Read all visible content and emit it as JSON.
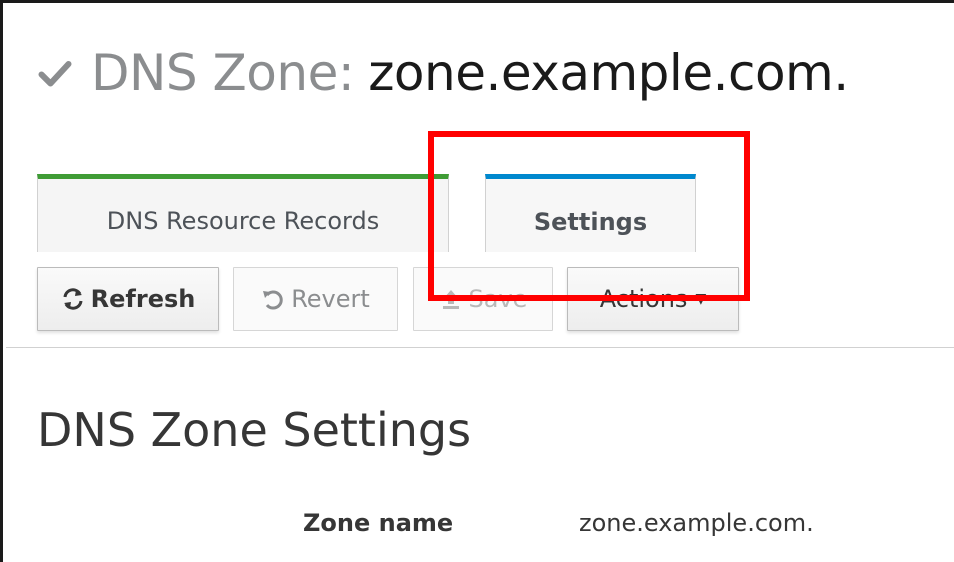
{
  "page": {
    "title_prefix": "DNS Zone:",
    "title_name": "zone.example.com.",
    "status_icon": "check-icon"
  },
  "tabs": [
    {
      "label": "DNS Resource Records",
      "accent": "#3f9c35",
      "active": false
    },
    {
      "label": "Settings",
      "accent": "#0088ce",
      "active": true
    }
  ],
  "toolbar": {
    "refresh_label": "Refresh",
    "refresh_icon": "refresh-icon",
    "revert_label": "Revert",
    "revert_icon": "undo-icon",
    "save_label": "Save",
    "save_icon": "upload-icon",
    "actions_label": "Actions",
    "actions_icon": "caret-down-icon"
  },
  "section": {
    "title": "DNS Zone Settings"
  },
  "fields": [
    {
      "label": "Zone name",
      "value": "zone.example.com."
    }
  ],
  "annotation": {
    "highlight_color": "#ff0000"
  }
}
